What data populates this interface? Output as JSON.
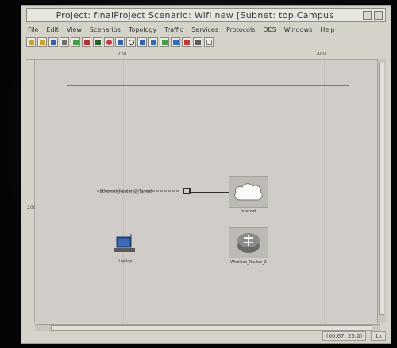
{
  "window": {
    "title": "Project: finalProject Scenario: Wifi new  [Subnet: top.Campus"
  },
  "menu": [
    "File",
    "Edit",
    "View",
    "Scenarios",
    "Topology",
    "Traffic",
    "Services",
    "Protocols",
    "DES",
    "Windows",
    "Help"
  ],
  "toolbar": {
    "icons": [
      "open-icon",
      "save-icon",
      "print-icon",
      "copy-icon",
      "object-palette-icon",
      "link-icon",
      "failure-icon",
      "recover-icon",
      "search-icon",
      "zoom-icon",
      "dropdown-icon",
      "statistics-icon",
      "results-icon",
      "animation-icon",
      "edit-icon",
      "attributes-icon",
      "run-icon"
    ]
  },
  "ruler": {
    "top_ticks": [
      "200",
      "400"
    ],
    "left_ticks": [
      "200"
    ]
  },
  "canvas": {
    "nodes": {
      "router_label": "Ethernet_Router_2_Tunnel",
      "cloud_label": "Internet",
      "server_label": "Wireless_Router_2",
      "workstation_label": "Laptop"
    }
  },
  "statusbar": {
    "coords": "(00.67, 25.0)",
    "zoom": "1x"
  },
  "colors": {
    "subnet_border": "#e04a4a",
    "window_bg": "#d5d2ca"
  }
}
